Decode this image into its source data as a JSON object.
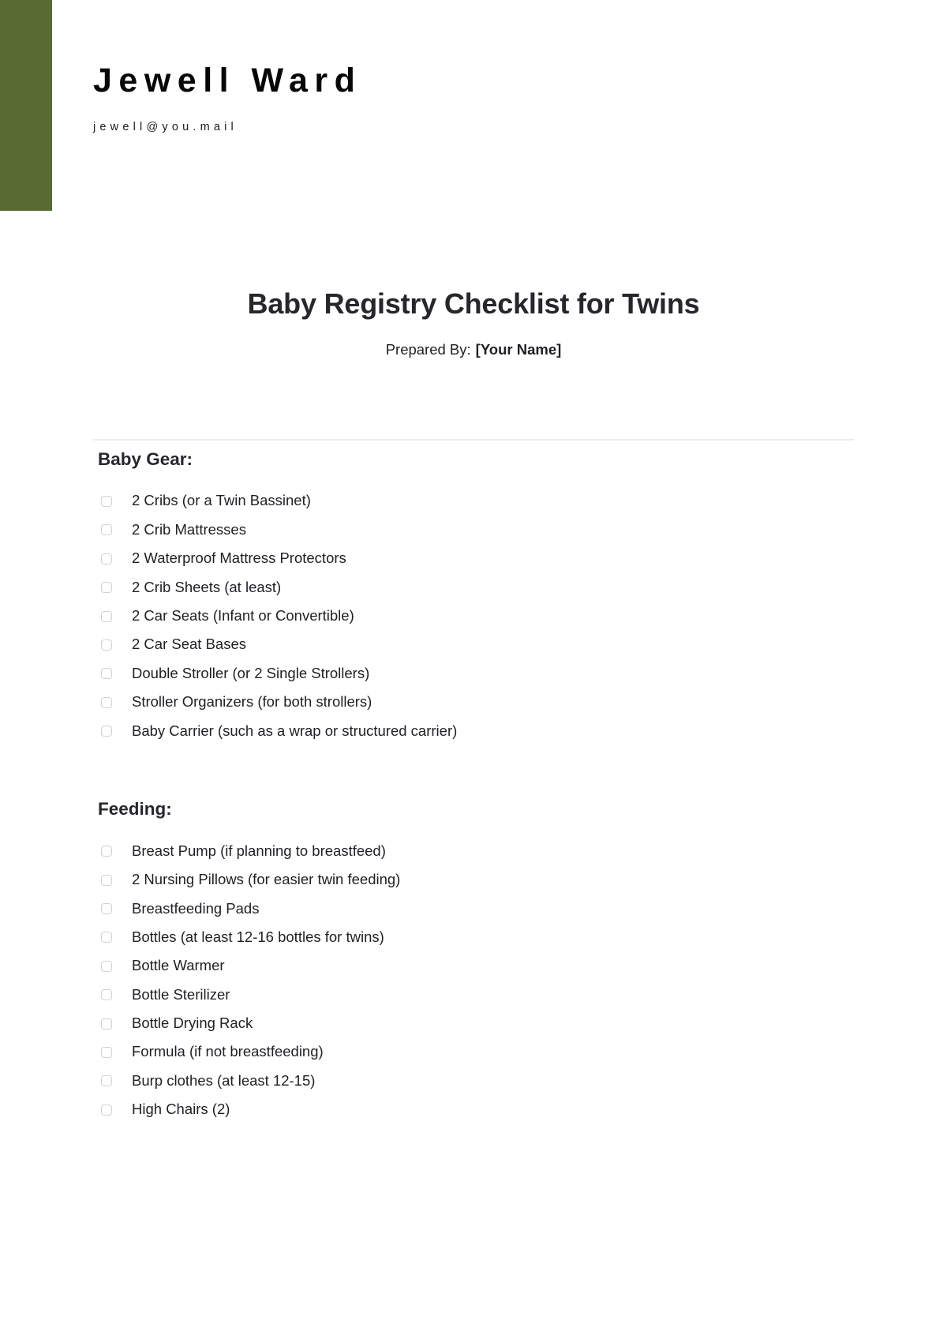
{
  "brand": {
    "name": "Jewell Ward",
    "email": "jewell@you.mail",
    "accent_color": "#586b33"
  },
  "document": {
    "title": "Baby Registry Checklist for Twins",
    "prepared_by_label": "Prepared By:",
    "prepared_by_value": "[Your Name]"
  },
  "sections": [
    {
      "title": "Baby Gear:",
      "items": [
        {
          "label": "2 Cribs (or a Twin Bassinet)",
          "checked": false
        },
        {
          "label": "2 Crib Mattresses",
          "checked": false
        },
        {
          "label": "2 Waterproof Mattress Protectors",
          "checked": false
        },
        {
          "label": "2 Crib Sheets (at least)",
          "checked": false
        },
        {
          "label": "2 Car Seats (Infant or Convertible)",
          "checked": false
        },
        {
          "label": "2 Car Seat Bases",
          "checked": false
        },
        {
          "label": "Double Stroller (or 2 Single Strollers)",
          "checked": false
        },
        {
          "label": "Stroller Organizers (for both strollers)",
          "checked": false
        },
        {
          "label": "Baby Carrier (such as a wrap or structured carrier)",
          "checked": false
        }
      ]
    },
    {
      "title": "Feeding:",
      "items": [
        {
          "label": "Breast Pump (if planning to breastfeed)",
          "checked": false
        },
        {
          "label": "2 Nursing Pillows (for easier twin feeding)",
          "checked": false
        },
        {
          "label": "Breastfeeding Pads",
          "checked": false
        },
        {
          "label": "Bottles (at least 12-16 bottles for twins)",
          "checked": false
        },
        {
          "label": "Bottle Warmer",
          "checked": false
        },
        {
          "label": "Bottle Sterilizer",
          "checked": false
        },
        {
          "label": "Bottle Drying Rack",
          "checked": false
        },
        {
          "label": "Formula (if not breastfeeding)",
          "checked": false
        },
        {
          "label": "Burp clothes (at least 12-15)",
          "checked": false
        },
        {
          "label": "High Chairs (2)",
          "checked": false
        }
      ]
    }
  ]
}
